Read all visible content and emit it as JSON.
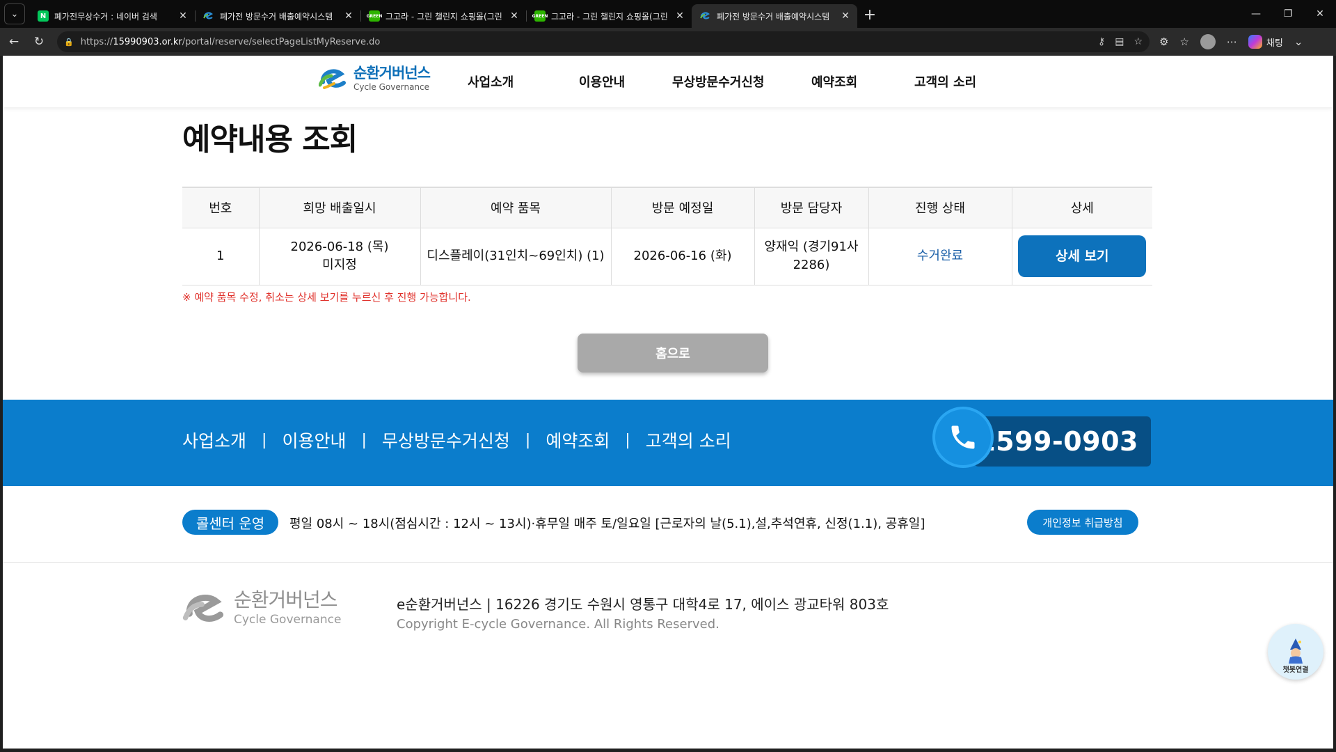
{
  "browser": {
    "tabs": [
      {
        "title": "폐가전무상수거 : 네이버 검색",
        "favicon": "naver-icon",
        "active": false
      },
      {
        "title": "폐가전 방문수거 배출예약시스템",
        "favicon": "ecycle-icon",
        "active": false
      },
      {
        "title": "그고라 - 그린 챌린지 쇼핑몰(그린",
        "favicon": "greenchallenge-icon",
        "active": false
      },
      {
        "title": "그고라 - 그린 챌린지 쇼핑몰(그린",
        "favicon": "greenchallenge-icon",
        "active": false
      },
      {
        "title": "폐가전 방문수거 배출예약시스템",
        "favicon": "ecycle-icon",
        "active": true
      }
    ],
    "url_scheme": "https://",
    "url_host": "15990903.or.kr",
    "url_path": "/portal/reserve/selectPageListMyReserve.do",
    "copilot_label": "채팅",
    "tab_new_glyph": "+",
    "tab_close_glyph": "✕",
    "favicon_labels": {
      "naver": "N",
      "green": "GREEN"
    }
  },
  "site": {
    "logo_kr": "순환거버넌스",
    "logo_en": "Cycle Governance",
    "gnb": [
      "사업소개",
      "이용안내",
      "무상방문수거신청",
      "예약조회",
      "고객의 소리"
    ]
  },
  "page": {
    "title": "예약내용 조회",
    "table": {
      "headers": [
        "번호",
        "희망 배출일시",
        "예약 품목",
        "방문 예정일",
        "방문 담당자",
        "진행 상태",
        "상세"
      ],
      "rows": [
        {
          "no": "1",
          "desired_date": "2026-06-18 (목)",
          "desired_time": "미지정",
          "item": "디스플레이(31인치~69인치) (1)",
          "visit_date": "2026-06-16 (화)",
          "manager_name": "양재익 (경기91사",
          "manager_code": "2286)",
          "status": "수거완료",
          "detail_label": "상세 보기"
        }
      ]
    },
    "notice": "※ 예약 품목 수정, 취소는 상세 보기를 누르신 후 진행 가능합니다.",
    "home_label": "홈으로"
  },
  "footer": {
    "nav": [
      "사업소개",
      "이용안내",
      "무상방문수거신청",
      "예약조회",
      "고객의 소리"
    ],
    "nav_separator": "|",
    "phone": "1599-0903",
    "callcenter_badge": "콜센터 운영",
    "callcenter_hours": "평일 08시 ~ 18시(점심시간 : 12시 ~ 13시)·휴무일 매주 토/일요일   [근로자의 날(5.1),설,추석연휴, 신정(1.1), 공휴일]",
    "privacy_label": "개인정보 취급방침",
    "logo_kr": "순환거버넌스",
    "logo_en": "Cycle Governance",
    "address": "e순환거버넌스  | 16226 경기도 수원시 영통구 대학4로 17, 에이스 광교타워 803호",
    "copyright": "Copyright E-cycle Governance. All Rights Reserved.",
    "chatbot_label": "챗봇연결"
  },
  "colors": {
    "brand_blue": "#0b7dcc",
    "button_blue": "#0d72bc",
    "notice_red": "#e0312b",
    "status_blue": "#1a5fa8",
    "home_gray": "#a9a9a9"
  }
}
